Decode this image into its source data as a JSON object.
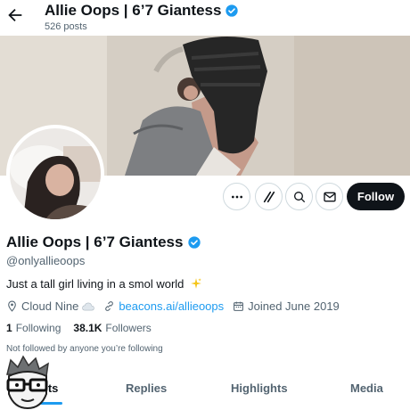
{
  "header": {
    "title": "Allie Oops | 6’7 Giantess",
    "posts": "526 posts"
  },
  "profile": {
    "display_name": "Allie Oops | 6’7 Giantess",
    "handle": "@onlyallieoops",
    "bio": "Just a tall girl living in a smol world",
    "location": "Cloud Nine",
    "link": "beacons.ai/allieoops",
    "joined": "Joined June 2019",
    "following_count": "1",
    "following_label": "Following",
    "followers_count": "38.1K",
    "followers_label": "Followers",
    "not_followed_text": "Not followed by anyone you’re following"
  },
  "actions": {
    "follow_label": "Follow"
  },
  "tabs": [
    {
      "label": "Posts"
    },
    {
      "label": "Replies"
    },
    {
      "label": "Highlights"
    },
    {
      "label": "Media"
    }
  ],
  "colors": {
    "accent": "#1d9bf0",
    "text": "#0f1419",
    "muted": "#536471",
    "follow_bg": "#0f1419"
  },
  "icons": [
    "back-arrow-icon",
    "verified-badge-icon",
    "more-icon",
    "x-logo-icon",
    "search-icon",
    "mail-icon",
    "location-pin-icon",
    "cloud-icon",
    "link-icon",
    "calendar-icon",
    "sparkle-icon"
  ]
}
